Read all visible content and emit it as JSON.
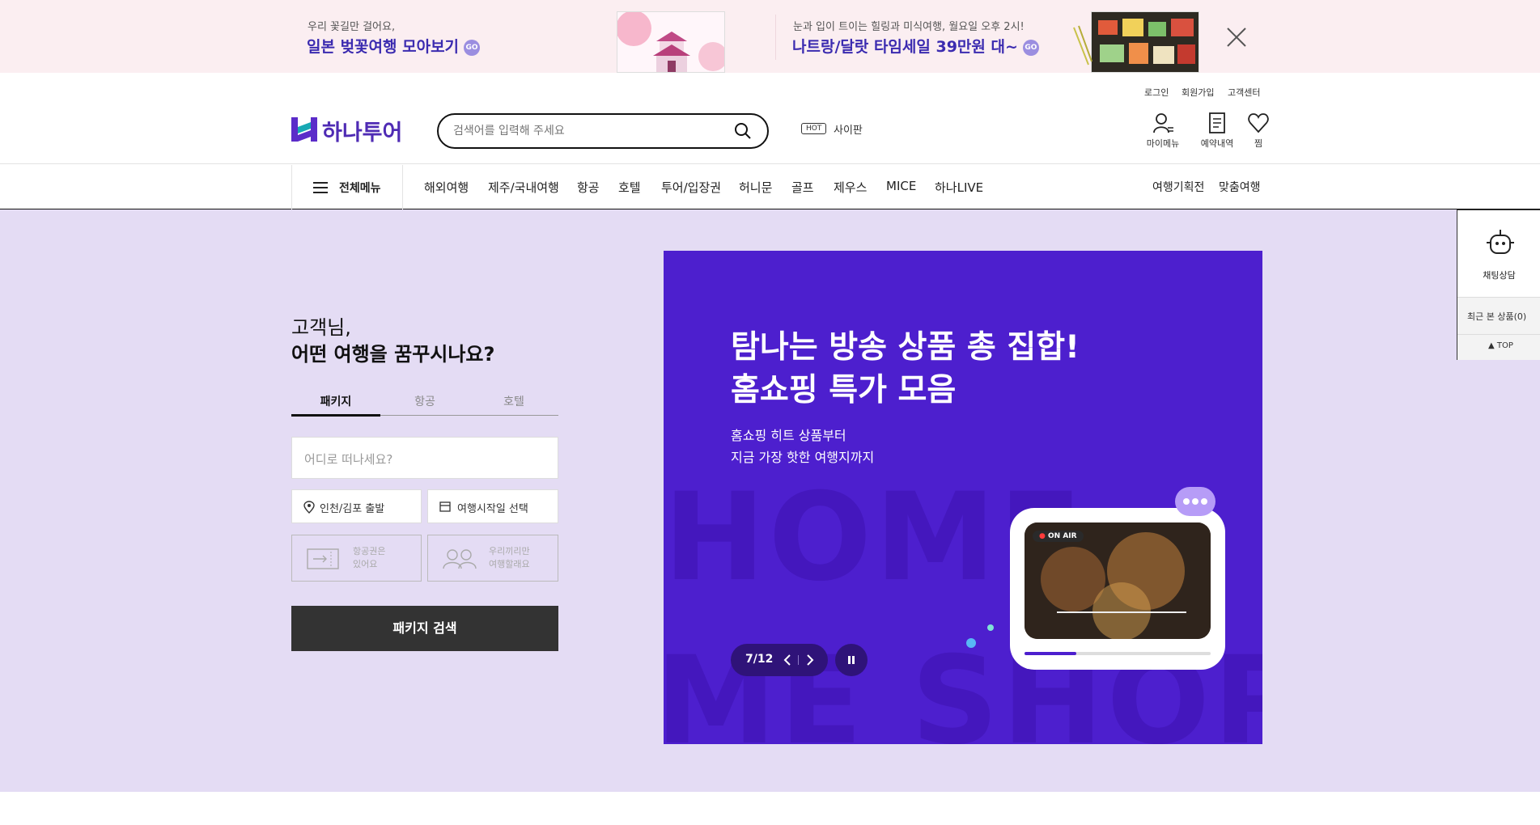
{
  "promo": {
    "left": {
      "small": "우리 꽃길만 걸어요,",
      "big": "일본 벚꽃여행 모아보기",
      "go": "GO"
    },
    "right": {
      "small": "눈과 입이 트이는 힐링과 미식여행, 월요일 오후 2시!",
      "big": "나트랑/달랏 타임세일 39만원 대~",
      "go": "GO"
    },
    "close_icon": "close-icon"
  },
  "header": {
    "logo_text": "하나투어",
    "util": [
      "로그인",
      "회원가입",
      "고객센터"
    ],
    "search_placeholder": "검색어를 입력해 주세요",
    "hot_badge": "HOT",
    "hot_text": "사이판",
    "icons": [
      {
        "label": "마이메뉴",
        "icon": "user-icon"
      },
      {
        "label": "예약내역",
        "icon": "document-icon"
      },
      {
        "label": "찜",
        "icon": "heart-icon"
      }
    ]
  },
  "nav": {
    "all_menu": "전체메뉴",
    "items": [
      "해외여행",
      "제주/국내여행",
      "항공",
      "호텔",
      "투어/입장권",
      "허니문",
      "골프",
      "제우스",
      "MICE",
      "하나LIVE"
    ],
    "right_items": [
      "여행기획전",
      "맞춤여행"
    ]
  },
  "search_panel": {
    "greeting_1": "고객님,",
    "greeting_2": "어떤 여행을 꿈꾸시나요?",
    "tabs": [
      "패키지",
      "항공",
      "호텔"
    ],
    "active_tab": "패키지",
    "destination_placeholder": "어디로 떠나세요?",
    "departure": "인천/김포 출발",
    "date": "여행시작일 선택",
    "option_1": "항공권은 있어요",
    "option_1_lines": [
      "항공권은",
      "있어요"
    ],
    "option_2": "우리끼리만 여행할래요",
    "option_2_lines": [
      "우리끼리만",
      "여행할래요"
    ],
    "search_button": "패키지 검색"
  },
  "slide": {
    "headline_1": "탐나는 방송 상품 총 집합!",
    "headline_2": "홈쇼핑 특가 모음",
    "sub_1": "홈쇼핑 히트 상품부터",
    "sub_2": "지금 가장 핫한 여행지까지",
    "watermark_1": "HOME",
    "watermark_2": "ME SHOPP",
    "on_air": "ON AIR",
    "pager": "7/12",
    "colors": {
      "background": "#4d1fce",
      "pager": "#2f1379"
    }
  },
  "side": {
    "chat_label": "채팅상담",
    "recent": "최근 본 상품(0)",
    "top": "TOP"
  }
}
